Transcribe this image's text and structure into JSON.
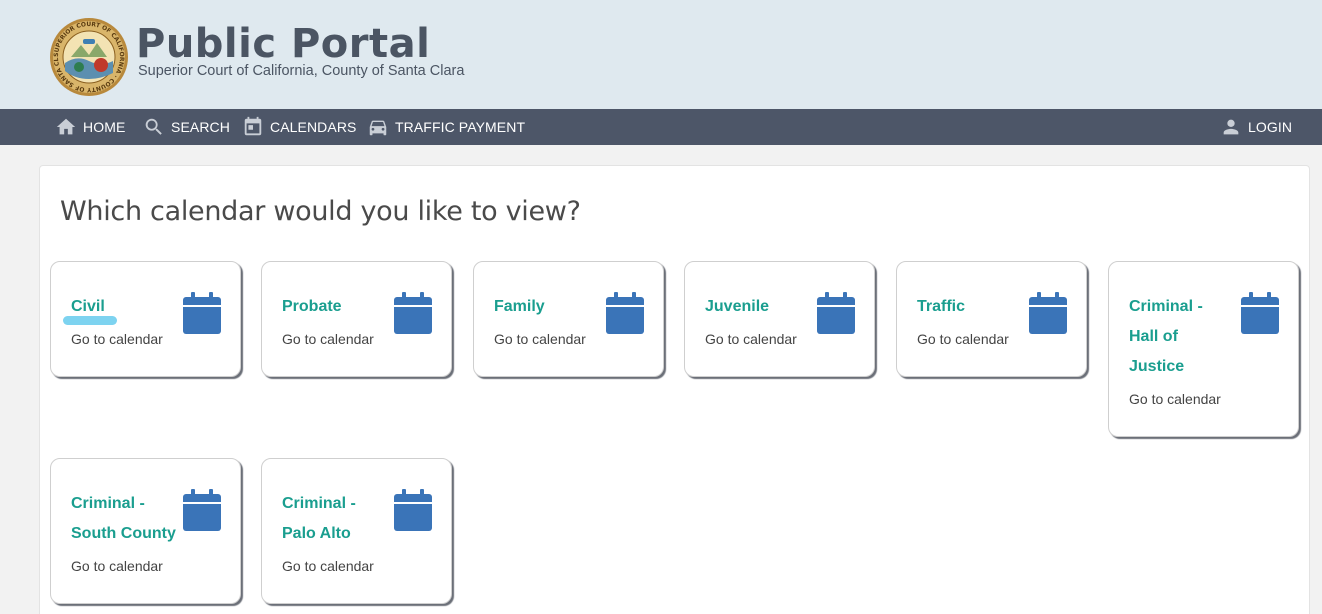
{
  "header": {
    "seal_text": "SUPERIOR COURT OF CALIFORNIA · COUNTY OF SANTA CLARA",
    "title": "Public Portal",
    "subtitle": "Superior Court of California, County of Santa Clara"
  },
  "nav": {
    "home": "HOME",
    "search": "SEARCH",
    "calendars": "CALENDARS",
    "traffic_payment": "TRAFFIC PAYMENT",
    "login": "LOGIN"
  },
  "main": {
    "question": "Which calendar would you like to view?",
    "go_label": "Go to calendar",
    "cards": [
      {
        "title": "Civil"
      },
      {
        "title": "Probate"
      },
      {
        "title": "Family"
      },
      {
        "title": "Juvenile"
      },
      {
        "title": "Traffic"
      },
      {
        "title": "Criminal - Hall of Justice"
      },
      {
        "title": "Criminal - South County"
      },
      {
        "title": "Criminal - Palo Alto"
      }
    ]
  },
  "colors": {
    "header_bg": "#dfe9ef",
    "nav_bg": "#4d5668",
    "card_title": "#1a9e8f",
    "calendar_icon": "#3a74b8"
  }
}
